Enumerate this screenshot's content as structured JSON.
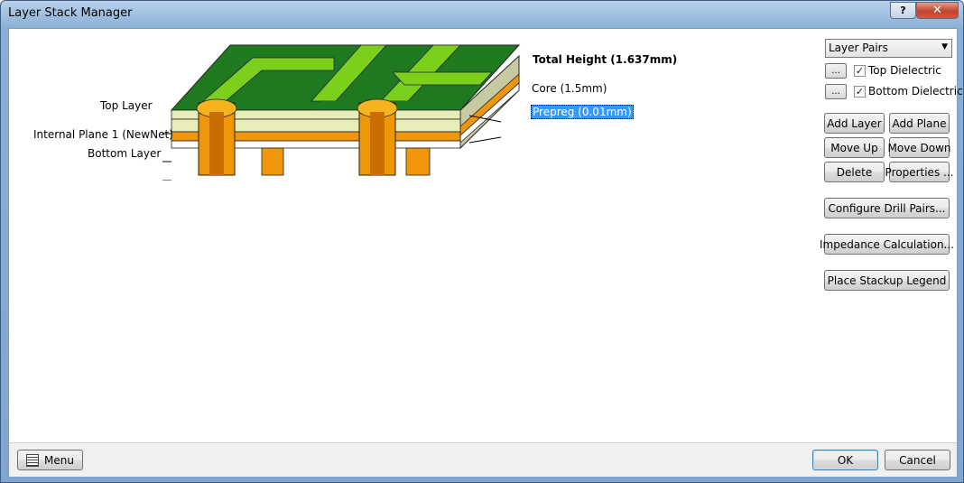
{
  "window": {
    "title": "Layer Stack Manager",
    "help_label": "?",
    "close_label": "✕"
  },
  "diagram": {
    "total_height": "Total Height (1.637mm)",
    "core": "Core (1.5mm)",
    "prepreg": "Prepreg (0.01mm)",
    "top_layer": "Top Layer",
    "internal_plane": "Internal Plane 1 (NewNet)",
    "bottom_layer": "Bottom Layer"
  },
  "sidebar": {
    "view_select": "Layer Pairs",
    "top_dielectric": {
      "label": "Top Dielectric",
      "checked": true
    },
    "bottom_dielectric": {
      "label": "Bottom Dielectric",
      "checked": true
    },
    "ellipsis": "...",
    "add_layer": "Add Layer",
    "add_plane": "Add Plane",
    "move_up": "Move Up",
    "move_down": "Move Down",
    "delete": "Delete",
    "properties": "Properties ...",
    "configure_drill_pairs": "Configure Drill Pairs...",
    "impedance_calculation": "Impedance Calculation...",
    "place_stackup_legend": "Place Stackup Legend"
  },
  "footer": {
    "menu": "Menu",
    "ok": "OK",
    "cancel": "Cancel"
  },
  "colors": {
    "pcb_green": "#1f7a1f",
    "trace_lime": "#7ccf1a",
    "copper_orange": "#f0960a",
    "core_cream": "#e8ecb8",
    "selection_blue": "#3399ff"
  }
}
